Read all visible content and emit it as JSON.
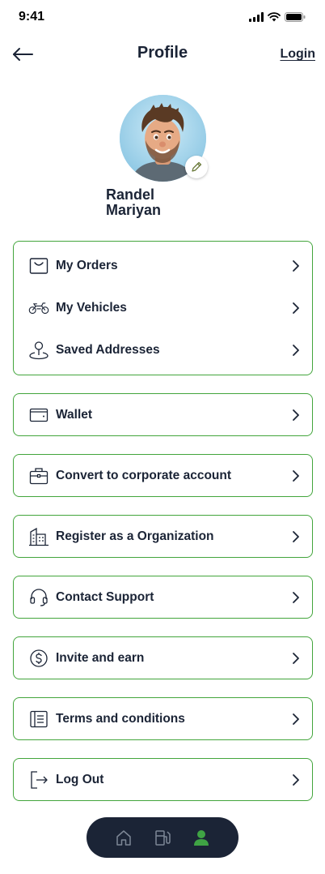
{
  "status_bar": {
    "time": "9:41"
  },
  "header": {
    "title": "Profile",
    "login_label": "Login"
  },
  "profile": {
    "first_name": "Randel",
    "last_name": "Mariyan"
  },
  "menu": {
    "group1": [
      {
        "label": "My Orders",
        "icon": "bag-icon"
      },
      {
        "label": "My Vehicles",
        "icon": "motorbike-icon"
      },
      {
        "label": "Saved Addresses",
        "icon": "location-pin-icon"
      }
    ],
    "wallet": {
      "label": "Wallet",
      "icon": "wallet-icon"
    },
    "corporate": {
      "label": "Convert to corporate account",
      "icon": "briefcase-icon"
    },
    "organization": {
      "label": "Register as a Organization",
      "icon": "building-icon"
    },
    "support": {
      "label": "Contact Support",
      "icon": "headset-icon"
    },
    "invite": {
      "label": "Invite and earn",
      "icon": "dollar-coin-icon"
    },
    "terms": {
      "label": "Terms and conditions",
      "icon": "document-icon"
    },
    "logout": {
      "label": "Log Out",
      "icon": "logout-icon"
    }
  },
  "bottom_nav": {
    "items": [
      {
        "icon": "home-icon",
        "active": false
      },
      {
        "icon": "fuel-pump-icon",
        "active": false
      },
      {
        "icon": "profile-icon",
        "active": true
      }
    ]
  },
  "colors": {
    "accent": "#43a53c",
    "text": "#1b2436",
    "nav_bg": "#1b2436"
  }
}
